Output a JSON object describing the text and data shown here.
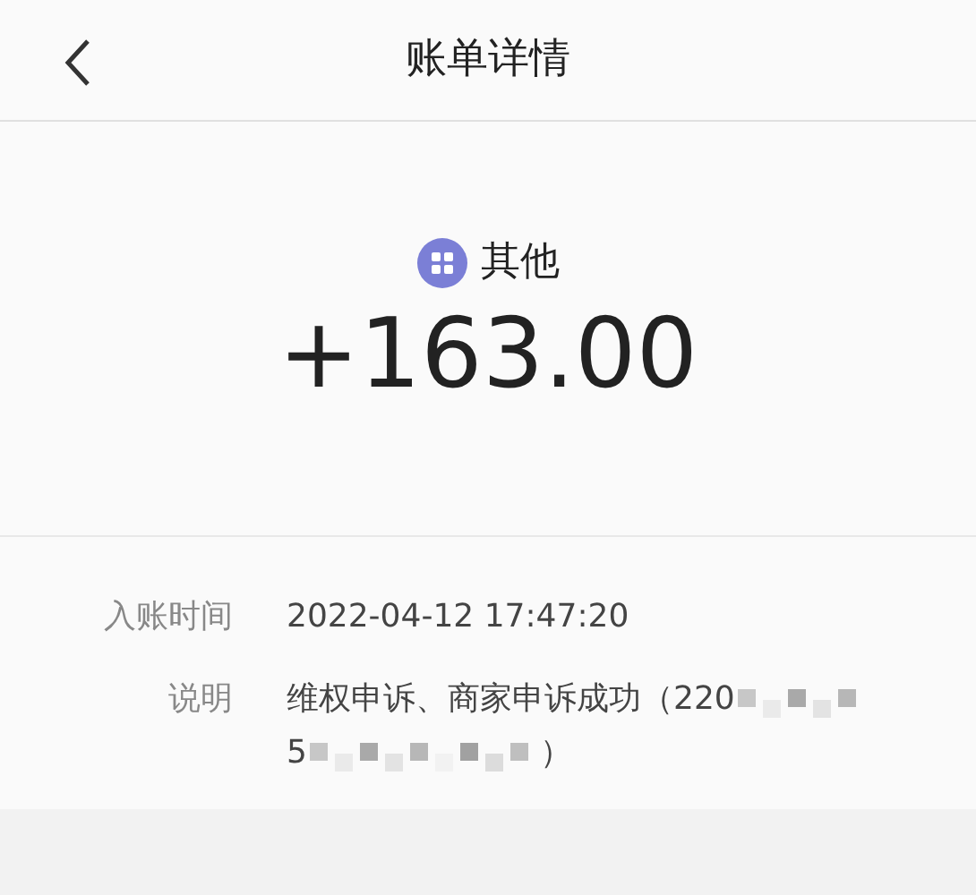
{
  "header": {
    "title": "账单详情"
  },
  "summary": {
    "category": "其他",
    "amount": "+163.00"
  },
  "details": [
    {
      "label": "入账时间",
      "lines": [
        [
          "2022-04-12 17:47:20"
        ]
      ]
    },
    {
      "label": "说明",
      "lines": [
        [
          "维权申诉、商家申诉成功（220"
        ],
        [
          "5",
          "）"
        ]
      ]
    }
  ]
}
